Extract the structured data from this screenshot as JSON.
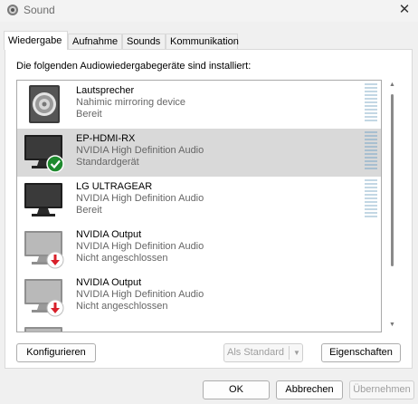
{
  "window": {
    "title": "Sound",
    "close_glyph": "✕"
  },
  "tabs": [
    {
      "label": "Wiedergabe",
      "active": true
    },
    {
      "label": "Aufnahme",
      "active": false
    },
    {
      "label": "Sounds",
      "active": false
    },
    {
      "label": "Kommunikation",
      "active": false
    }
  ],
  "instruction": "Die folgenden Audiowiedergabegeräte sind installiert:",
  "devices": [
    {
      "name": "Lautsprecher",
      "driver": "Nahimic mirroring device",
      "status": "Bereit",
      "icon": "speaker-icon",
      "selected": false
    },
    {
      "name": "EP-HDMI-RX",
      "driver": "NVIDIA High Definition Audio",
      "status": "Standardgerät",
      "icon": "monitor-default-icon",
      "selected": true
    },
    {
      "name": "LG ULTRAGEAR",
      "driver": "NVIDIA High Definition Audio",
      "status": "Bereit",
      "icon": "monitor-icon",
      "selected": false
    },
    {
      "name": "NVIDIA Output",
      "driver": "NVIDIA High Definition Audio",
      "status": "Nicht angeschlossen",
      "icon": "monitor-disconnected-icon",
      "selected": false
    },
    {
      "name": "NVIDIA Output",
      "driver": "NVIDIA High Definition Audio",
      "status": "Nicht angeschlossen",
      "icon": "monitor-disconnected-icon",
      "selected": false
    }
  ],
  "buttons": {
    "configure": "Konfigurieren",
    "set_default": "Als Standard",
    "properties": "Eigenschaften",
    "ok": "OK",
    "cancel": "Abbrechen",
    "apply": "Übernehmen"
  },
  "colors": {
    "selection": "#d9d9d9",
    "check_green": "#1e8a2e",
    "alert_red": "#d8202a",
    "meter": "#b4cfe0"
  }
}
